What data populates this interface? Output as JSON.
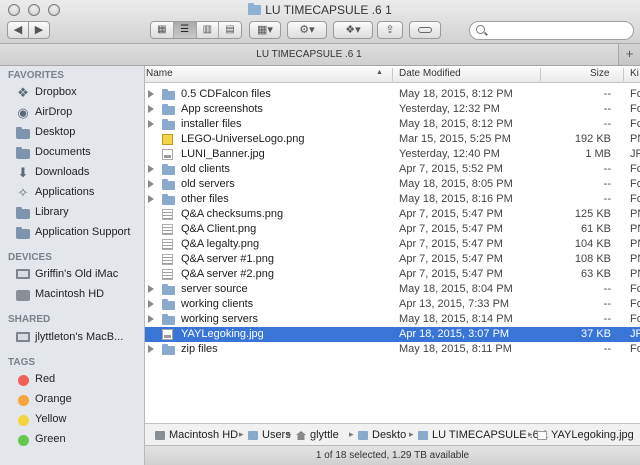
{
  "window": {
    "title": "LU TIMECAPSULE .6 1",
    "tab_title": "LU TIMECAPSULE .6 1"
  },
  "toolbar": {
    "back": "◀",
    "forward": "▶",
    "views": [
      "▦",
      "☰",
      "▥",
      "▤"
    ],
    "arrange": "▦▾",
    "action": "⚙▾",
    "dropbox": "❖▾",
    "share": "⇪",
    "search_placeholder": "",
    "tab_add": "+"
  },
  "sidebar": {
    "favorites_label": "FAVORITES",
    "favorites": [
      {
        "label": "Dropbox",
        "icon": "dropbox-icon"
      },
      {
        "label": "AirDrop",
        "icon": "airdrop-icon"
      },
      {
        "label": "Desktop",
        "icon": "desktop-folder-icon"
      },
      {
        "label": "Documents",
        "icon": "documents-folder-icon"
      },
      {
        "label": "Downloads",
        "icon": "downloads-icon"
      },
      {
        "label": "Applications",
        "icon": "applications-icon"
      },
      {
        "label": "Library",
        "icon": "library-folder-icon"
      },
      {
        "label": "Application Support",
        "icon": "folder-icon"
      }
    ],
    "devices_label": "DEVICES",
    "devices": [
      {
        "label": "Griffin's Old iMac",
        "icon": "imac-icon"
      },
      {
        "label": "Macintosh HD",
        "icon": "hard-disk-icon"
      }
    ],
    "shared_label": "SHARED",
    "shared": [
      {
        "label": "jlyttleton's MacB...",
        "icon": "macbook-icon"
      }
    ],
    "tags_label": "TAGS",
    "tags": [
      {
        "label": "Red",
        "color": "#f2605a"
      },
      {
        "label": "Orange",
        "color": "#f6a43b"
      },
      {
        "label": "Yellow",
        "color": "#f5d33f"
      },
      {
        "label": "Green",
        "color": "#66c84b"
      }
    ]
  },
  "columns": {
    "name": "Name",
    "date": "Date Modified",
    "size": "Size",
    "kind": "Ki"
  },
  "files": [
    {
      "name": "0.5 CDFalcon files",
      "date": "May 18, 2015, 8:12 PM",
      "size": "--",
      "kind": "Fo",
      "type": "folder"
    },
    {
      "name": "App screenshots",
      "date": "Yesterday, 12:32 PM",
      "size": "--",
      "kind": "Fo",
      "type": "folder"
    },
    {
      "name": "installer files",
      "date": "May 18, 2015, 8:12 PM",
      "size": "--",
      "kind": "Fo",
      "type": "folder"
    },
    {
      "name": "LEGO-UniverseLogo.png",
      "date": "Mar 15, 2015, 5:25 PM",
      "size": "192 KB",
      "kind": "PN",
      "type": "logo"
    },
    {
      "name": "LUNI_Banner.jpg",
      "date": "Yesterday, 12:40 PM",
      "size": "1 MB",
      "kind": "JP",
      "type": "image"
    },
    {
      "name": "old clients",
      "date": "Apr 7, 2015, 5:52 PM",
      "size": "--",
      "kind": "Fo",
      "type": "folder"
    },
    {
      "name": "old servers",
      "date": "May 18, 2015, 8:05 PM",
      "size": "--",
      "kind": "Fo",
      "type": "folder"
    },
    {
      "name": "other files",
      "date": "May 18, 2015, 8:16 PM",
      "size": "--",
      "kind": "Fo",
      "type": "folder"
    },
    {
      "name": "Q&A checksums.png",
      "date": "Apr 7, 2015, 5:47 PM",
      "size": "125 KB",
      "kind": "PN",
      "type": "lines"
    },
    {
      "name": "Q&A Client.png",
      "date": "Apr 7, 2015, 5:47 PM",
      "size": "61 KB",
      "kind": "PN",
      "type": "lines"
    },
    {
      "name": "Q&A legalty.png",
      "date": "Apr 7, 2015, 5:47 PM",
      "size": "104 KB",
      "kind": "PN",
      "type": "lines"
    },
    {
      "name": "Q&A server #1.png",
      "date": "Apr 7, 2015, 5:47 PM",
      "size": "108 KB",
      "kind": "PN",
      "type": "lines"
    },
    {
      "name": "Q&A server #2.png",
      "date": "Apr 7, 2015, 5:47 PM",
      "size": "63 KB",
      "kind": "PN",
      "type": "lines"
    },
    {
      "name": "server source",
      "date": "May 18, 2015, 8:04 PM",
      "size": "--",
      "kind": "Fo",
      "type": "folder"
    },
    {
      "name": "working clients",
      "date": "Apr 13, 2015, 7:33 PM",
      "size": "--",
      "kind": "Fo",
      "type": "folder"
    },
    {
      "name": "working servers",
      "date": "May 18, 2015, 8:14 PM",
      "size": "--",
      "kind": "Fo",
      "type": "folder"
    },
    {
      "name": "YAYLegoking.jpg",
      "date": "Apr 18, 2015, 3:07 PM",
      "size": "37 KB",
      "kind": "JP",
      "type": "image",
      "selected": true
    },
    {
      "name": "zip files",
      "date": "May 18, 2015, 8:11 PM",
      "size": "--",
      "kind": "Fo",
      "type": "folder"
    }
  ],
  "pathbar": [
    {
      "label": "Macintosh HD",
      "icon": "disk"
    },
    {
      "label": "Users",
      "icon": "folder"
    },
    {
      "label": "glyttle",
      "icon": "home"
    },
    {
      "label": "Deskto",
      "icon": "folder"
    },
    {
      "label": "LU TIMECAPSULE .6 1",
      "icon": "folder"
    },
    {
      "label": "YAYLegoking.jpg",
      "icon": "img"
    }
  ],
  "status": "1 of 18 selected, 1.29 TB available",
  "colors": {
    "selection": "#3875d7",
    "sidebar_bg": "#e3e7ec"
  }
}
